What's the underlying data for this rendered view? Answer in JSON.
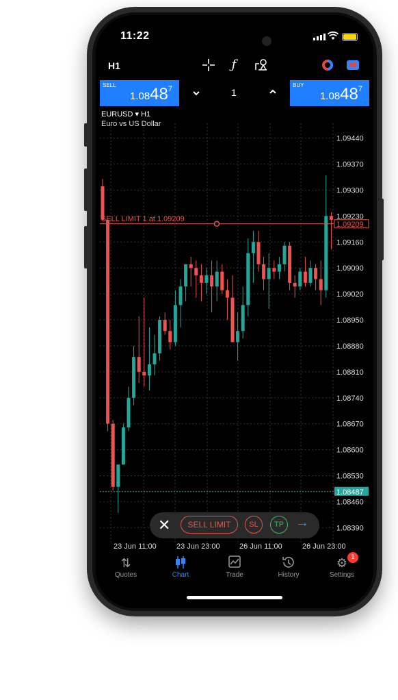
{
  "status": {
    "time": "11:22"
  },
  "toolbar": {
    "timeframe": "H1",
    "tools": [
      "crosshair-icon",
      "function-icon",
      "shapes-icon",
      "indicator-circle-icon",
      "chat-icon"
    ]
  },
  "trade": {
    "sell_label": "SELL",
    "sell_price_main": "1.08",
    "sell_price_big": "48",
    "sell_price_sup": "7",
    "buy_label": "BUY",
    "buy_price_main": "1.08",
    "buy_price_big": "48",
    "buy_price_sup": "7",
    "quantity": "1",
    "down_icon": "chevron-down-icon",
    "up_icon": "chevron-up-icon"
  },
  "symbol": {
    "name": "EURUSD ▾ H1",
    "description": "Euro vs US Dollar"
  },
  "chart_data": {
    "type": "candlestick",
    "symbol": "EURUSD",
    "timeframe": "H1",
    "ylim": [
      1.0835,
      1.0948
    ],
    "y_ticks": [
      "1.09440",
      "1.09370",
      "1.09300",
      "1.09230",
      "1.09160",
      "1.09090",
      "1.09020",
      "1.08950",
      "1.08880",
      "1.08810",
      "1.08740",
      "1.08670",
      "1.08600",
      "1.08530",
      "1.08460",
      "1.08390"
    ],
    "x_ticks": [
      "23 Jun 11:00",
      "23 Jun 23:00",
      "26 Jun 11:00",
      "26 Jun 23:00"
    ],
    "current_price": "1.08487",
    "order_line": {
      "label": "SELL LIMIT 1 at 1.09209",
      "price": "1.09209"
    },
    "candles": [
      {
        "o": 1.0931,
        "h": 1.0933,
        "l": 1.0922,
        "c": 1.0922
      },
      {
        "o": 1.0922,
        "h": 1.0922,
        "l": 1.0865,
        "c": 1.0867
      },
      {
        "o": 1.0867,
        "h": 1.0868,
        "l": 1.0849,
        "c": 1.085
      },
      {
        "o": 1.085,
        "h": 1.0853,
        "l": 1.0843,
        "c": 1.0856
      },
      {
        "o": 1.0856,
        "h": 1.0867,
        "l": 1.0856,
        "c": 1.0866
      },
      {
        "o": 1.0866,
        "h": 1.0877,
        "l": 1.0865,
        "c": 1.0874
      },
      {
        "o": 1.0874,
        "h": 1.0888,
        "l": 1.0872,
        "c": 1.0885
      },
      {
        "o": 1.0885,
        "h": 1.0896,
        "l": 1.0878,
        "c": 1.0881
      },
      {
        "o": 1.0881,
        "h": 1.0901,
        "l": 1.0877,
        "c": 1.088
      },
      {
        "o": 1.088,
        "h": 1.0893,
        "l": 1.0876,
        "c": 1.0883
      },
      {
        "o": 1.0883,
        "h": 1.0891,
        "l": 1.088,
        "c": 1.0886
      },
      {
        "o": 1.0886,
        "h": 1.0896,
        "l": 1.0884,
        "c": 1.0895
      },
      {
        "o": 1.0895,
        "h": 1.0897,
        "l": 1.0891,
        "c": 1.0892
      },
      {
        "o": 1.0892,
        "h": 1.0895,
        "l": 1.0887,
        "c": 1.0889
      },
      {
        "o": 1.0889,
        "h": 1.0903,
        "l": 1.0888,
        "c": 1.0899
      },
      {
        "o": 1.0899,
        "h": 1.0906,
        "l": 1.0893,
        "c": 1.0904
      },
      {
        "o": 1.0904,
        "h": 1.091,
        "l": 1.09,
        "c": 1.091
      },
      {
        "o": 1.091,
        "h": 1.0912,
        "l": 1.0904,
        "c": 1.0909
      },
      {
        "o": 1.0909,
        "h": 1.0911,
        "l": 1.0901,
        "c": 1.0907
      },
      {
        "o": 1.0907,
        "h": 1.091,
        "l": 1.09,
        "c": 1.0905
      },
      {
        "o": 1.0905,
        "h": 1.0909,
        "l": 1.0902,
        "c": 1.0907
      },
      {
        "o": 1.0907,
        "h": 1.0911,
        "l": 1.0897,
        "c": 1.0904
      },
      {
        "o": 1.0904,
        "h": 1.0911,
        "l": 1.09,
        "c": 1.0908
      },
      {
        "o": 1.0908,
        "h": 1.091,
        "l": 1.0902,
        "c": 1.0903
      },
      {
        "o": 1.0903,
        "h": 1.0906,
        "l": 1.0895,
        "c": 1.0901
      },
      {
        "o": 1.0901,
        "h": 1.0907,
        "l": 1.0891,
        "c": 1.0889
      },
      {
        "o": 1.0889,
        "h": 1.0897,
        "l": 1.0884,
        "c": 1.0892
      },
      {
        "o": 1.0892,
        "h": 1.0904,
        "l": 1.089,
        "c": 1.0899
      },
      {
        "o": 1.0899,
        "h": 1.0917,
        "l": 1.0896,
        "c": 1.0913
      },
      {
        "o": 1.0913,
        "h": 1.0919,
        "l": 1.0905,
        "c": 1.0916
      },
      {
        "o": 1.0916,
        "h": 1.0919,
        "l": 1.0908,
        "c": 1.091
      },
      {
        "o": 1.091,
        "h": 1.0912,
        "l": 1.0903,
        "c": 1.0906
      },
      {
        "o": 1.0906,
        "h": 1.0913,
        "l": 1.0898,
        "c": 1.0909
      },
      {
        "o": 1.0909,
        "h": 1.0911,
        "l": 1.0906,
        "c": 1.0908
      },
      {
        "o": 1.0908,
        "h": 1.0912,
        "l": 1.0906,
        "c": 1.091
      },
      {
        "o": 1.091,
        "h": 1.0916,
        "l": 1.0908,
        "c": 1.0915
      },
      {
        "o": 1.0915,
        "h": 1.0916,
        "l": 1.0903,
        "c": 1.0905
      },
      {
        "o": 1.0905,
        "h": 1.0907,
        "l": 1.0901,
        "c": 1.0904
      },
      {
        "o": 1.0904,
        "h": 1.0909,
        "l": 1.0903,
        "c": 1.0908
      },
      {
        "o": 1.0908,
        "h": 1.0912,
        "l": 1.0904,
        "c": 1.0905
      },
      {
        "o": 1.0905,
        "h": 1.0911,
        "l": 1.0904,
        "c": 1.0909
      },
      {
        "o": 1.0909,
        "h": 1.091,
        "l": 1.0903,
        "c": 1.0906
      },
      {
        "o": 1.0906,
        "h": 1.0911,
        "l": 1.0899,
        "c": 1.0903
      },
      {
        "o": 1.0903,
        "h": 1.0934,
        "l": 1.0901,
        "c": 1.0923
      },
      {
        "o": 1.0923,
        "h": 1.0924,
        "l": 1.0914,
        "c": 1.0922
      }
    ]
  },
  "order_pill": {
    "close_label": "✕",
    "sell_limit": "SELL LIMIT",
    "sl": "SL",
    "tp": "TP",
    "arrow": "→"
  },
  "tabs": [
    {
      "label": "Quotes",
      "icon": "quotes-arrows-icon"
    },
    {
      "label": "Chart",
      "icon": "candles-icon"
    },
    {
      "label": "Trade",
      "icon": "trade-chart-icon"
    },
    {
      "label": "History",
      "icon": "history-clock-icon"
    },
    {
      "label": "Settings",
      "icon": "gear-icon",
      "badge": "1"
    }
  ],
  "colors": {
    "bull": "#26a69a",
    "bear": "#ef5350",
    "accent": "#2f86ff",
    "order": "#e0584e"
  }
}
